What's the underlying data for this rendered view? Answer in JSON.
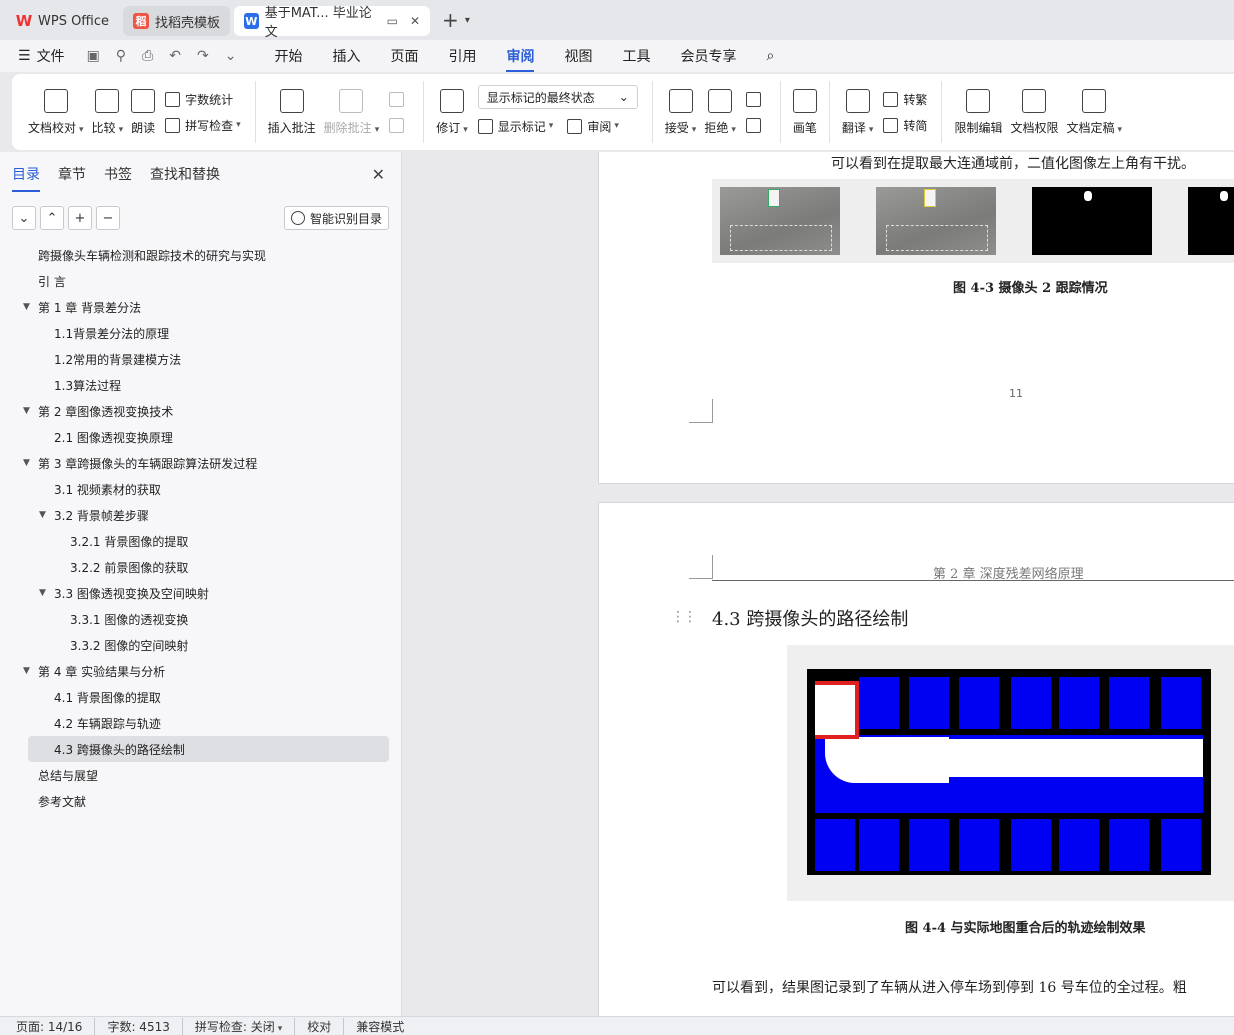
{
  "tabs": {
    "wps": "WPS Office",
    "daoke": "找稻壳模板",
    "doc": "基于MAT... 毕业论文"
  },
  "menu": {
    "file": "文件",
    "items": [
      "开始",
      "插入",
      "页面",
      "引用",
      "审阅",
      "视图",
      "工具",
      "会员专享"
    ],
    "active": "审阅"
  },
  "ribbon": {
    "doc_check": "文档校对",
    "compare": "比较",
    "read_aloud": "朗读",
    "word_count": "字数统计",
    "spell_check": "拼写检查",
    "insert_comment": "插入批注",
    "delete_comment": "删除批注",
    "revise": "修订",
    "display_select": "显示标记的最终状态",
    "show_markup": "显示标记",
    "review": "审阅",
    "accept": "接受",
    "reject": "拒绝",
    "pen": "画笔",
    "translate": "翻译",
    "to_traditional": "转繁",
    "to_simplified": "转简",
    "restrict_edit": "限制编辑",
    "doc_permission": "文档权限",
    "finalize": "文档定稿"
  },
  "nav": {
    "tabs": [
      "目录",
      "章节",
      "书签",
      "查找和替换"
    ],
    "smart_toc": "智能识别目录",
    "toc": [
      {
        "text": "跨摄像头车辆检测和跟踪技术的研究与实现",
        "level": 1
      },
      {
        "text": "引  言",
        "level": 1
      },
      {
        "text": "第 1 章  背景差分法",
        "level": 1,
        "expanded": true
      },
      {
        "text": "1.1背景差分法的原理",
        "level": 2
      },
      {
        "text": "1.2常用的背景建模方法",
        "level": 2
      },
      {
        "text": "1.3算法过程",
        "level": 2
      },
      {
        "text": "第 2 章图像透视变换技术",
        "level": 1,
        "expanded": true
      },
      {
        "text": "2.1 图像透视变换原理",
        "level": 2
      },
      {
        "text": "第 3 章跨摄像头的车辆跟踪算法研发过程",
        "level": 1,
        "expanded": true
      },
      {
        "text": "3.1 视频素材的获取",
        "level": 2
      },
      {
        "text": "3.2  背景帧差步骤",
        "level": 2,
        "expanded": true
      },
      {
        "text": "3.2.1 背景图像的提取",
        "level": 3
      },
      {
        "text": "3.2.2 前景图像的获取",
        "level": 3
      },
      {
        "text": "3.3  图像透视变换及空间映射",
        "level": 2,
        "expanded": true
      },
      {
        "text": "3.3.1 图像的透视变换",
        "level": 3
      },
      {
        "text": "3.3.2 图像的空间映射",
        "level": 3
      },
      {
        "text": "第 4 章  实验结果与分析",
        "level": 1,
        "expanded": true
      },
      {
        "text": "4.1  背景图像的提取",
        "level": 2
      },
      {
        "text": "4.2  车辆跟踪与轨迹",
        "level": 2
      },
      {
        "text": "4.3  跨摄像头的路径绘制",
        "level": 2,
        "selected": true
      },
      {
        "text": "总结与展望",
        "level": 1
      },
      {
        "text": "参考文献",
        "level": 1
      }
    ]
  },
  "document": {
    "page1_text": "可以看到在提取最大连通域前，二值化图像左上角有干扰。",
    "fig43_caption": "图 4-3 摄像头 2 跟踪情况",
    "page_number": "11",
    "header": "第 2 章  深度残差网络原理",
    "heading": "4.3  跨摄像头的路径绘制",
    "fig44_caption": "图 4-4 与实际地图重合后的轨迹绘制效果",
    "page2_text": "可以看到，结果图记录到了车辆从进入停车场到停到 16 号车位的全过程。粗"
  },
  "status": {
    "page": "页面: 14/16",
    "words": "字数: 4513",
    "spell": "拼写检查: 关闭",
    "proof": "校对",
    "compat": "兼容模式"
  }
}
